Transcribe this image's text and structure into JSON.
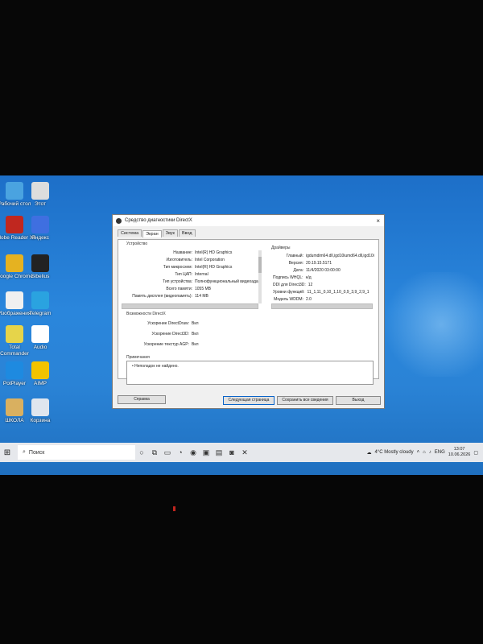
{
  "desktop_icons": [
    {
      "label": "Рабочий стол",
      "color": "#4aa3e0"
    },
    {
      "label": "Adobe Reader XI",
      "color": "#c0271f"
    },
    {
      "label": "Google Chrome",
      "color": "#e5b221"
    },
    {
      "label": "Изображения",
      "color": "#f0f0f0"
    },
    {
      "label": "Total Commander",
      "color": "#e6d44a"
    },
    {
      "label": "PotPlayer",
      "color": "#1e8ae0"
    },
    {
      "label": "ШКОЛА",
      "color": "#d9b060"
    },
    {
      "label": "Этот",
      "color": "#dddddd"
    },
    {
      "label": "Яндекс",
      "color": "#3f6fe0"
    },
    {
      "label": "Sibelius",
      "color": "#222222"
    },
    {
      "label": "Telegram",
      "color": "#2aa3e0"
    },
    {
      "label": "Audio",
      "color": "#ffffff"
    },
    {
      "label": "AIMP",
      "color": "#f2c300"
    },
    {
      "label": "Корзина",
      "color": "#dfe6ee"
    }
  ],
  "dialog": {
    "title": "Средство диагностики DirectX",
    "close": "×",
    "tabs": [
      "Система",
      "Экран",
      "Звук",
      "Ввод"
    ],
    "device_group": "Устройство",
    "drivers_group": "Драйверы",
    "directx_group": "Возможности DirectX",
    "notes_group": "Примечания",
    "device_rows": [
      {
        "k": "Название:",
        "v": "Intel(R) HD Graphics"
      },
      {
        "k": "Изготовитель:",
        "v": "Intel Corporation"
      },
      {
        "k": "Тип микросхем:",
        "v": "Intel(R) HD Graphics"
      },
      {
        "k": "Тип ЦАП:",
        "v": "Internal"
      },
      {
        "k": "Тип устройства:",
        "v": "Полнофункциональный видеоадап"
      },
      {
        "k": "Всего памяти:",
        "v": "1055 MB"
      },
      {
        "k": "Память дисплея (видеопамять):",
        "v": "114 MB"
      }
    ],
    "driver_rows": [
      {
        "k": "Главный:",
        "v": "igdumdim64.dll,igd10iumd64.dll,igd10i"
      },
      {
        "k": "Версия:",
        "v": "20.19.15.5171"
      },
      {
        "k": "Дата:",
        "v": "11/4/2020 03:00:00"
      },
      {
        "k": "Подпись WHQL:",
        "v": "н/д"
      },
      {
        "k": "DDI для Direct3D:",
        "v": "12"
      },
      {
        "k": "Уровни функций:",
        "v": "11_1,11_0,10_1,10_0,9_3,9_2,9_1"
      },
      {
        "k": "Модель WDDM:",
        "v": "2.0"
      }
    ],
    "features": [
      {
        "k": "Ускорение DirectDraw:",
        "v": "Вкл"
      },
      {
        "k": "Ускорение Direct3D:",
        "v": "Вкл"
      },
      {
        "k": "Ускорение текстур AGP:",
        "v": "Вкл"
      }
    ],
    "note": "Неполадок не найдено.",
    "buttons": {
      "help": "Справка",
      "next": "Следующая страница",
      "save": "Сохранить все сведения",
      "exit": "Выход"
    }
  },
  "taskbar": {
    "start": "⊞",
    "search_placeholder": "Поиск",
    "weather": "4°C  Mostly cloudy",
    "lang": "ENG",
    "time": "13:07",
    "date": "10.06.2026"
  }
}
